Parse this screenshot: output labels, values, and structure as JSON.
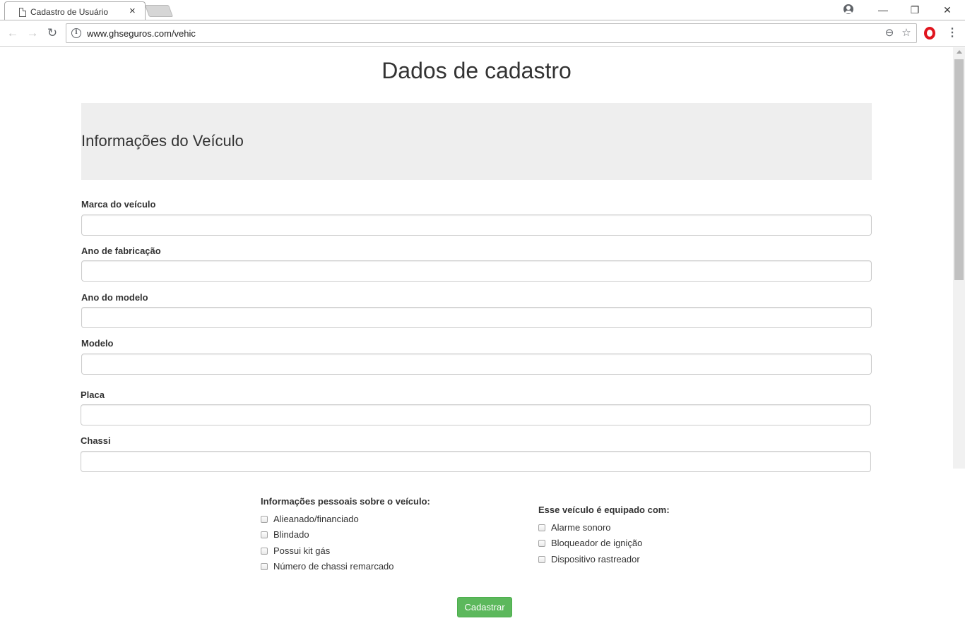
{
  "browser": {
    "tab_title": "Cadastro de Usuário",
    "tab_close": "×",
    "url": "www.ghseguros.com/vehic",
    "minimize": "—",
    "restore": "❐",
    "close": "✕",
    "back": "←",
    "forward": "→",
    "reload": "↻",
    "zoom_glyph": "⊖",
    "star_glyph": "☆",
    "menu_glyph": "⋮",
    "info_glyph": "i",
    "opera_color": "#e0151e"
  },
  "page": {
    "title": "Dados de cadastro",
    "section_title": "Informações do Veículo",
    "fields": [
      {
        "label": "Marca do veículo",
        "value": ""
      },
      {
        "label": "Ano de fabricação",
        "value": ""
      },
      {
        "label": "Ano do modelo",
        "value": ""
      },
      {
        "label": "Modelo",
        "value": ""
      },
      {
        "label": "Placa",
        "value": ""
      },
      {
        "label": "Chassi",
        "value": ""
      }
    ],
    "personal_group": {
      "title": "Informações pessoais sobre o veículo:",
      "options": [
        "Alieanado/financiado",
        "Blindado",
        "Possui kit gás",
        "Número de chassi remarcado"
      ]
    },
    "equipment_group": {
      "title": "Esse veículo é equipado com:",
      "options": [
        "Alarme sonoro",
        "Bloqueador de ignição",
        "Dispositivo rastreador"
      ]
    },
    "submit_label": "Cadastrar",
    "submit_color": "#5cb85c"
  }
}
